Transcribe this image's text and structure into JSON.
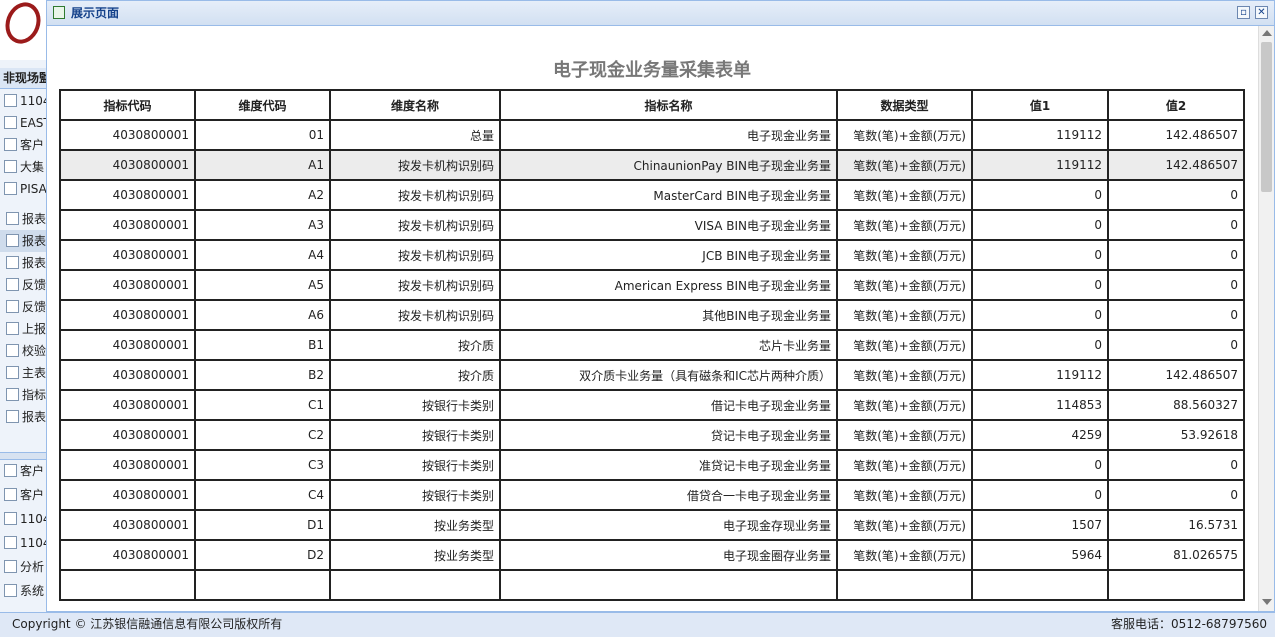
{
  "sidebar": {
    "section_title": "非现场監",
    "items": [
      {
        "label": "1104",
        "icon": "report-icon"
      },
      {
        "label": "EAST",
        "icon": "document-edit-icon"
      },
      {
        "label": "客户",
        "icon": "excel-icon"
      },
      {
        "label": "大集",
        "icon": "edit-icon"
      },
      {
        "label": "PISA",
        "icon": "document-icon"
      },
      {
        "label": "报表",
        "icon": "document-icon"
      },
      {
        "label": "报表",
        "icon": "document-icon"
      },
      {
        "label": "报表",
        "icon": "document-icon"
      },
      {
        "label": "反馈",
        "icon": "document-arrow-icon"
      },
      {
        "label": "反馈",
        "icon": "excel-icon"
      },
      {
        "label": "上报",
        "icon": "upload-document-icon"
      },
      {
        "label": "校验",
        "icon": "document-icon"
      },
      {
        "label": "主表",
        "icon": "document-icon"
      },
      {
        "label": "指标",
        "icon": "document-icon"
      },
      {
        "label": "报表",
        "icon": "document-icon"
      }
    ],
    "bottom_items": [
      {
        "label": "客户",
        "icon": "checklist-icon"
      },
      {
        "label": "客户",
        "icon": "checklist-icon"
      },
      {
        "label": "1104",
        "icon": "checklist-icon"
      },
      {
        "label": "1104",
        "icon": "checklist-icon"
      },
      {
        "label": "分析",
        "icon": "bar-chart-icon"
      },
      {
        "label": "系统",
        "icon": "gear-icon"
      }
    ]
  },
  "window": {
    "title": "展示页面",
    "restore_icon": "restore-icon",
    "close_icon": "close-icon"
  },
  "report": {
    "title": "电子现金业务量采集表单",
    "columns": [
      "指标代码",
      "维度代码",
      "维度名称",
      "指标名称",
      "数据类型",
      "值1",
      "值2"
    ],
    "rows": [
      [
        "4030800001",
        "01",
        "总量",
        "电子现金业务量",
        "笔数(笔)+金额(万元)",
        "119112",
        "142.486507"
      ],
      [
        "4030800001",
        "A1",
        "按发卡机构识别码",
        "ChinaunionPay BIN电子现金业务量",
        "笔数(笔)+金额(万元)",
        "119112",
        "142.486507"
      ],
      [
        "4030800001",
        "A2",
        "按发卡机构识别码",
        "MasterCard BIN电子现金业务量",
        "笔数(笔)+金额(万元)",
        "0",
        "0"
      ],
      [
        "4030800001",
        "A3",
        "按发卡机构识别码",
        "VISA BIN电子现金业务量",
        "笔数(笔)+金额(万元)",
        "0",
        "0"
      ],
      [
        "4030800001",
        "A4",
        "按发卡机构识别码",
        "JCB BIN电子现金业务量",
        "笔数(笔)+金额(万元)",
        "0",
        "0"
      ],
      [
        "4030800001",
        "A5",
        "按发卡机构识别码",
        "American Express BIN电子现金业务量",
        "笔数(笔)+金额(万元)",
        "0",
        "0"
      ],
      [
        "4030800001",
        "A6",
        "按发卡机构识别码",
        "其他BIN电子现金业务量",
        "笔数(笔)+金额(万元)",
        "0",
        "0"
      ],
      [
        "4030800001",
        "B1",
        "按介质",
        "芯片卡业务量",
        "笔数(笔)+金额(万元)",
        "0",
        "0"
      ],
      [
        "4030800001",
        "B2",
        "按介质",
        "双介质卡业务量（具有磁条和IC芯片两种介质）",
        "笔数(笔)+金额(万元)",
        "119112",
        "142.486507"
      ],
      [
        "4030800001",
        "C1",
        "按银行卡类别",
        "借记卡电子现金业务量",
        "笔数(笔)+金额(万元)",
        "114853",
        "88.560327"
      ],
      [
        "4030800001",
        "C2",
        "按银行卡类别",
        "贷记卡电子现金业务量",
        "笔数(笔)+金额(万元)",
        "4259",
        "53.92618"
      ],
      [
        "4030800001",
        "C3",
        "按银行卡类别",
        "准贷记卡电子现金业务量",
        "笔数(笔)+金额(万元)",
        "0",
        "0"
      ],
      [
        "4030800001",
        "C4",
        "按银行卡类别",
        "借贷合一卡电子现金业务量",
        "笔数(笔)+金额(万元)",
        "0",
        "0"
      ],
      [
        "4030800001",
        "D1",
        "按业务类型",
        "电子现金存现业务量",
        "笔数(笔)+金额(万元)",
        "1507",
        "16.5731"
      ],
      [
        "4030800001",
        "D2",
        "按业务类型",
        "电子现金圈存业务量",
        "笔数(笔)+金额(万元)",
        "5964",
        "81.026575"
      ],
      [
        "",
        "",
        "",
        "",
        "",
        "",
        ""
      ]
    ],
    "highlighted_row": 1
  },
  "footer": {
    "copyright": "Copyright © 江苏银信融通信息有限公司版权所有",
    "phone": "客服电话：0512-68797560"
  }
}
